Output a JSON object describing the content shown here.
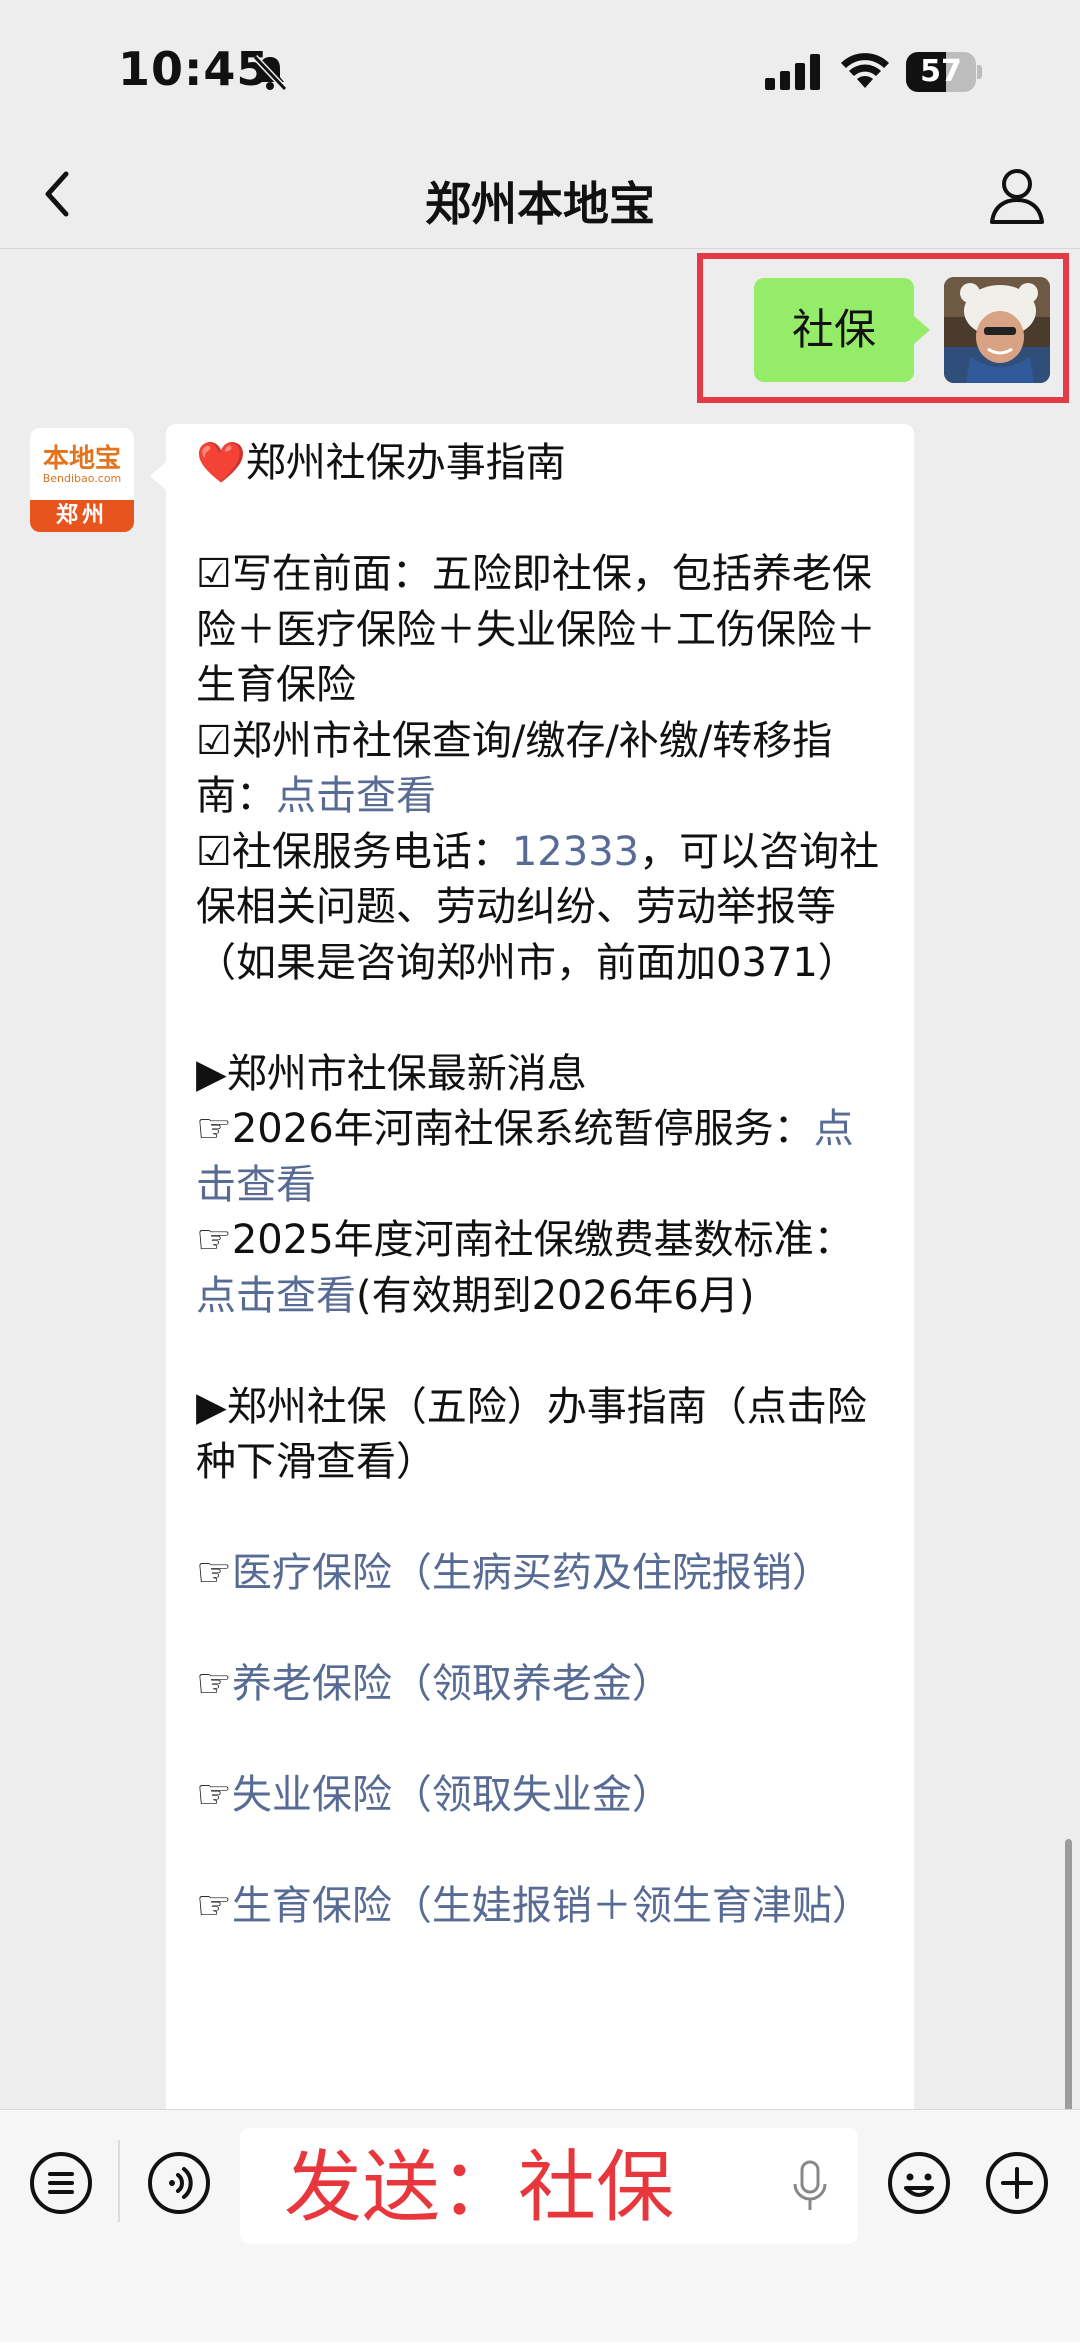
{
  "status_bar": {
    "time": "10:45",
    "battery": "57",
    "battery_level": 0.57
  },
  "nav": {
    "title": "郑州本地宝"
  },
  "chat": {
    "user_message": "社保",
    "bot_logo": {
      "top": "本地宝",
      "sub": "Bendibao.com",
      "city": "郑州"
    },
    "bot_message": [
      {
        "text": "❤️郑州社保办事指南\n\n☑写在前面：五险即社保，包括养老保险＋医疗保险＋失业保险＋工伤保险＋生育保险\n☑郑州市社保查询/缴存/补缴/转移指南："
      },
      {
        "text": "点击查看",
        "link": true
      },
      {
        "text": "\n☑社保服务电话："
      },
      {
        "text": "12333",
        "link": true
      },
      {
        "text": "，可以咨询社保相关问题、劳动纠纷、劳动举报等（如果是咨询郑州市，前面加0371）\n\n▶郑州市社保最新消息\n☞2026年河南社保系统暂停服务："
      },
      {
        "text": "点击查看",
        "link": true
      },
      {
        "text": "\n☞2025年度河南社保缴费基数标准："
      },
      {
        "text": "点击查看",
        "link": true
      },
      {
        "text": "(有效期到2026年6月)\n\n▶郑州社保（五险）办事指南（点击险种下滑查看）\n\n☞"
      },
      {
        "text": "医疗保险（生病买药及住院报销）",
        "link": true
      },
      {
        "text": "\n\n☞"
      },
      {
        "text": "养老保险（领取养老金）",
        "link": true
      },
      {
        "text": "\n\n☞"
      },
      {
        "text": "失业保险（领取失业金）",
        "link": true
      },
      {
        "text": "\n\n☞"
      },
      {
        "text": "生育保险（生娃报销＋领生育津贴）",
        "link": true
      }
    ]
  },
  "input_bar": {
    "overlay_text": "发送：社保"
  },
  "colors": {
    "accent_green": "#95ec69",
    "link": "#576b95",
    "highlight": "#e63946",
    "send_text": "#e8373c"
  }
}
